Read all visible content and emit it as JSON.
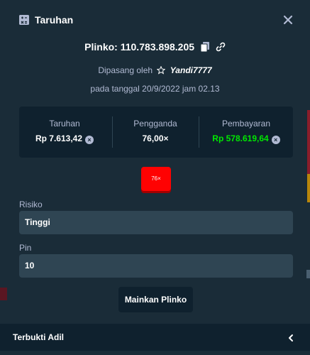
{
  "header": {
    "title": "Taruhan",
    "icon": "bet-slip-icon",
    "close_icon": "close-icon"
  },
  "bet": {
    "id_text": "Plinko: 110.783.898.205",
    "placed_by_prefix": "Dipasang oleh",
    "username": "Yandi7777",
    "date_text": "pada tanggal 20/9/2022 jam 02.13"
  },
  "stats": {
    "wager_label": "Taruhan",
    "wager_value": "Rp 7.613,42",
    "multiplier_label": "Pengganda",
    "multiplier_value": "76,00×",
    "payout_label": "Pembayaran",
    "payout_value": "Rp 578.619,64"
  },
  "result": {
    "chip_label": "76×",
    "chip_color": "#ff0202"
  },
  "form": {
    "risk_label": "Risiko",
    "risk_value": "Tinggi",
    "pins_label": "Pin",
    "pins_value": "10"
  },
  "actions": {
    "play_label": "Mainkan Plinko"
  },
  "footer": {
    "label": "Terbukti Adil"
  },
  "colors": {
    "background": "#1a2c38",
    "panel": "#0f212e",
    "input": "#2f4553",
    "muted_text": "#b1bad3",
    "win": "#00e701"
  }
}
